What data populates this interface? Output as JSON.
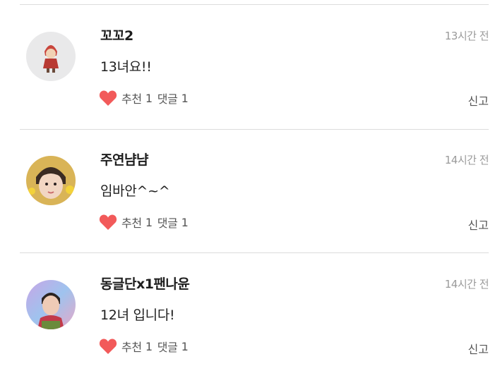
{
  "comments": [
    {
      "username": "꼬꼬2",
      "time": "13시간 전",
      "text": "13녀요!!",
      "like_label": "추천",
      "like_count": "1",
      "reply_label": "댓글",
      "reply_count": "1",
      "report_label": "신고"
    },
    {
      "username": "주연냠냠",
      "time": "14시간 전",
      "text": "임바안^~^",
      "like_label": "추천",
      "like_count": "1",
      "reply_label": "댓글",
      "reply_count": "1",
      "report_label": "신고"
    },
    {
      "username": "동글단x1팬나윤",
      "time": "14시간 전",
      "text": "12녀 입니다!",
      "like_label": "추천",
      "like_count": "1",
      "reply_label": "댓글",
      "reply_count": "1",
      "report_label": "신고"
    }
  ],
  "colors": {
    "heart": "#f25a5a",
    "divider": "#dcdcdc",
    "muted": "#9a9a9a"
  },
  "icons": [
    "heart-icon"
  ]
}
